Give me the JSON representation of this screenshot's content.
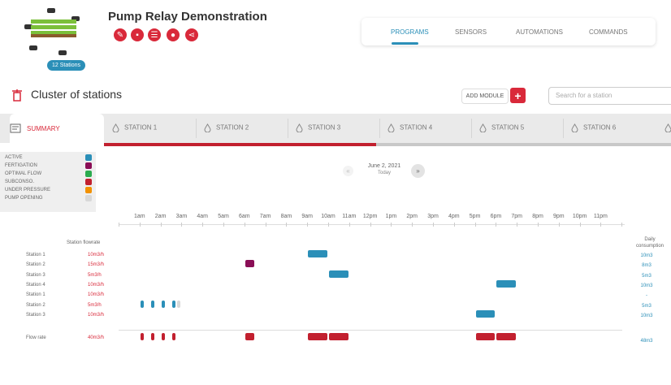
{
  "header": {
    "title": "Pump Relay Demonstration",
    "stations_badge": "12 Stations",
    "actions": [
      "edit-icon",
      "delete-icon",
      "list-icon",
      "drop-icon",
      "share-icon"
    ]
  },
  "nav": {
    "tabs": [
      "PROGRAMS",
      "SENSORS",
      "AUTOMATIONS",
      "COMMANDS"
    ],
    "active": "PROGRAMS"
  },
  "cluster": {
    "title": "Cluster of stations",
    "add_module": "ADD MODULE",
    "search_placeholder": "Search for a station"
  },
  "tabs": {
    "summary": "SUMMARY",
    "stations": [
      "STATION 1",
      "STATION 2",
      "STATION 3",
      "STATION 4",
      "STATION 5",
      "STATION 6"
    ]
  },
  "progress_fraction": 0.48,
  "legend": [
    {
      "label": "ACTIVE",
      "color": "#2b8fb8"
    },
    {
      "label": "FERTIGATION",
      "color": "#8a0e56"
    },
    {
      "label": "OPTIMAL FLOW",
      "color": "#2bab4f"
    },
    {
      "label": "SUBCONSO.",
      "color": "#c2202f"
    },
    {
      "label": "UNDER PRESSURE",
      "color": "#f29100"
    },
    {
      "label": "PUMP OPENING",
      "color": "#d8d8d8"
    }
  ],
  "date": {
    "main": "June 2, 2021",
    "sub": "Today",
    "prev_icon": "«",
    "next_icon": "»"
  },
  "hours": [
    "1am",
    "2am",
    "3am",
    "4am",
    "5am",
    "6am",
    "7am",
    "8am",
    "9am",
    "10am",
    "11am",
    "12pm",
    "1pm",
    "2pm",
    "3pm",
    "4pm",
    "5pm",
    "6pm",
    "7pm",
    "8pm",
    "9pm",
    "10pm",
    "11pm"
  ],
  "grid": {
    "flow_header": "Station flowrate",
    "consumption_header_1": "Daily",
    "consumption_header_2": "consumption",
    "rows": [
      {
        "name": "Station 1",
        "flow": "10m3/h",
        "consumption": "10m3",
        "bars": [
          {
            "start": 9.0,
            "end": 10.0,
            "state": "active"
          }
        ]
      },
      {
        "name": "Station 2",
        "flow": "15m3/h",
        "consumption": "8m3",
        "bars": [
          {
            "start": 6.0,
            "end": 6.5,
            "state": "fertigation"
          }
        ]
      },
      {
        "name": "Station 3",
        "flow": "5m3/h",
        "consumption": "5m3",
        "bars": [
          {
            "start": 10.0,
            "end": 11.0,
            "state": "active"
          }
        ]
      },
      {
        "name": "Station 4",
        "flow": "10m3/h",
        "consumption": "10m3",
        "bars": [
          {
            "start": 18.0,
            "end": 19.0,
            "state": "active"
          }
        ]
      },
      {
        "name": "Station 1",
        "flow": "10m3/h",
        "consumption": "-",
        "bars": []
      },
      {
        "name": "Station 2",
        "flow": "5m3/h",
        "consumption": "5m3",
        "bars": [
          {
            "start": 1.0,
            "end": 1.25,
            "state": "active"
          },
          {
            "start": 1.5,
            "end": 1.75,
            "state": "active"
          },
          {
            "start": 2.0,
            "end": 2.25,
            "state": "active"
          },
          {
            "start": 2.5,
            "end": 2.75,
            "state": "active"
          },
          {
            "start": 2.75,
            "end": 3.0,
            "state": "pump"
          }
        ]
      },
      {
        "name": "Station 3",
        "flow": "10m3/h",
        "consumption": "10m3",
        "bars": [
          {
            "start": 17.0,
            "end": 18.0,
            "state": "active"
          }
        ]
      }
    ],
    "total": {
      "name": "Flow rate",
      "flow": "40m3/h",
      "consumption": "48m3",
      "bars": [
        {
          "start": 1.0,
          "end": 1.25
        },
        {
          "start": 1.5,
          "end": 1.75
        },
        {
          "start": 2.0,
          "end": 2.25
        },
        {
          "start": 2.5,
          "end": 2.75
        },
        {
          "start": 6.0,
          "end": 6.5
        },
        {
          "start": 9.0,
          "end": 10.0
        },
        {
          "start": 10.0,
          "end": 11.0
        },
        {
          "start": 17.0,
          "end": 18.0
        },
        {
          "start": 18.0,
          "end": 19.0
        }
      ]
    }
  }
}
